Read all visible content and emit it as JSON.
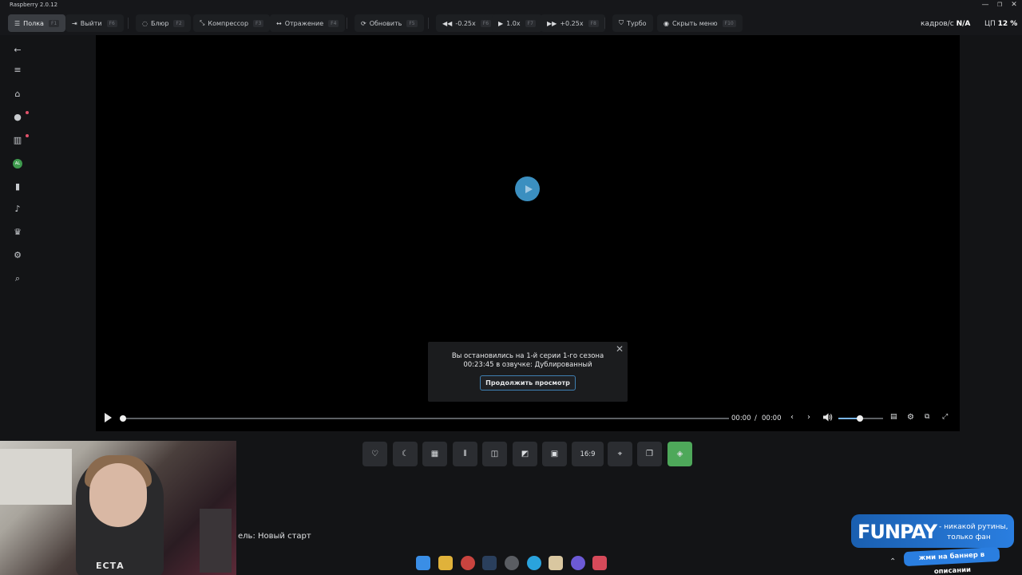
{
  "window": {
    "title": "Raspberry 2.0.12",
    "controls": {
      "minimize": "—",
      "maximize": "❐",
      "close": "✕"
    }
  },
  "toolbar": {
    "buttons": [
      {
        "id": "shelf",
        "label": "Полка",
        "key": "F1",
        "icon": "shelf-icon",
        "active": true
      },
      {
        "id": "exit",
        "label": "Выйти",
        "key": "F6",
        "icon": "exit-icon"
      },
      {
        "id": "blur",
        "label": "Блюр",
        "key": "F2",
        "icon": "blur-icon"
      },
      {
        "id": "compressor",
        "label": "Компрессор",
        "key": "F3",
        "icon": "compressor-icon"
      },
      {
        "id": "mirror",
        "label": "Отражение",
        "key": "F4",
        "icon": "mirror-icon"
      },
      {
        "id": "refresh",
        "label": "Обновить",
        "key": "F5",
        "icon": "refresh-icon"
      },
      {
        "id": "speed-down",
        "label": "-0.25x",
        "key": "F6",
        "icon": "rewind-icon"
      },
      {
        "id": "speed",
        "label": "1.0x",
        "key": "F7",
        "icon": "play-icon"
      },
      {
        "id": "speed-up",
        "label": "+0.25x",
        "key": "F8",
        "icon": "fast-forward-icon"
      },
      {
        "id": "turbo",
        "label": "Турбо",
        "key": "",
        "icon": "shield-icon"
      },
      {
        "id": "hide-menu",
        "label": "Скрыть меню",
        "key": "F10",
        "icon": "eye-icon"
      }
    ],
    "stats": {
      "fps_label": "кадров/с",
      "fps_value": "N/A",
      "cpu_label": "ЦП",
      "cpu_value": "12 %"
    }
  },
  "sidebar": {
    "items": [
      {
        "name": "back",
        "icon": "arrow-left-icon"
      },
      {
        "name": "menu",
        "icon": "menu-icon"
      },
      {
        "name": "home",
        "icon": "home-icon"
      },
      {
        "name": "popular",
        "icon": "fire-icon",
        "dot": true
      },
      {
        "name": "catalog",
        "icon": "book-icon",
        "dot": true
      },
      {
        "name": "profile",
        "icon": "avatar-icon"
      },
      {
        "name": "bookmarks",
        "icon": "bookmark-icon"
      },
      {
        "name": "notifications",
        "icon": "bell-icon"
      },
      {
        "name": "achievements",
        "icon": "trophy-icon"
      },
      {
        "name": "settings",
        "icon": "gear-icon"
      },
      {
        "name": "search",
        "icon": "search-icon"
      }
    ],
    "avatar_text": "AL"
  },
  "player": {
    "resume": {
      "line1": "Вы остановились на 1-й серии 1-го сезона",
      "line2": "00:23:45 в озвучке: Дублированный",
      "button": "Продолжить просмотр",
      "close": "✕"
    },
    "controls": {
      "current_time": "00:00",
      "separator": "/",
      "duration": "00:00",
      "progress": 0.0,
      "volume": 0.48
    }
  },
  "tools": [
    {
      "name": "favorite",
      "icon": "heart-icon"
    },
    {
      "name": "night-mode",
      "icon": "moon-icon"
    },
    {
      "name": "grid",
      "icon": "grid-icon"
    },
    {
      "name": "audio",
      "icon": "waveform-icon"
    },
    {
      "name": "split",
      "icon": "split-icon"
    },
    {
      "name": "crop",
      "icon": "crop-icon"
    },
    {
      "name": "pip",
      "icon": "pip-icon"
    },
    {
      "name": "aspect",
      "label": "16:9"
    },
    {
      "name": "screenshot",
      "icon": "focus-icon"
    },
    {
      "name": "copy",
      "icon": "copy-icon"
    },
    {
      "name": "layers",
      "icon": "layers-icon",
      "accent": "#4ea85a"
    }
  ],
  "stream_overlay": {
    "subtitle": "ель: Новый старт",
    "shirt_text": "ЕСТА"
  },
  "banner": {
    "logo": "FUNPAY",
    "tagline1": "- никакой рутины,",
    "tagline2": "только фан",
    "cta": "жми на баннер в описании"
  },
  "colors": {
    "accent_blue": "#3b8fc0",
    "accent_green": "#4ea85a",
    "dot_red": "#e0526a"
  }
}
